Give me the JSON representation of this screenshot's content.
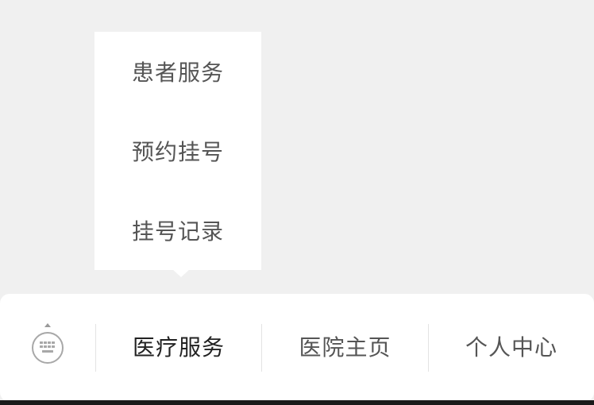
{
  "popup_menu": {
    "items": [
      {
        "label": "患者服务"
      },
      {
        "label": "预约挂号"
      },
      {
        "label": "挂号记录"
      }
    ]
  },
  "bottom_bar": {
    "keyboard_icon": "keyboard-toggle-icon",
    "tabs": [
      {
        "label": "医疗服务",
        "active": true
      },
      {
        "label": "医院主页",
        "active": false
      },
      {
        "label": "个人中心",
        "active": false
      }
    ]
  },
  "colors": {
    "background": "#f0f0f0",
    "surface": "#ffffff",
    "text_primary": "#222222",
    "text_secondary": "#555555",
    "divider": "#e3e3e3"
  }
}
